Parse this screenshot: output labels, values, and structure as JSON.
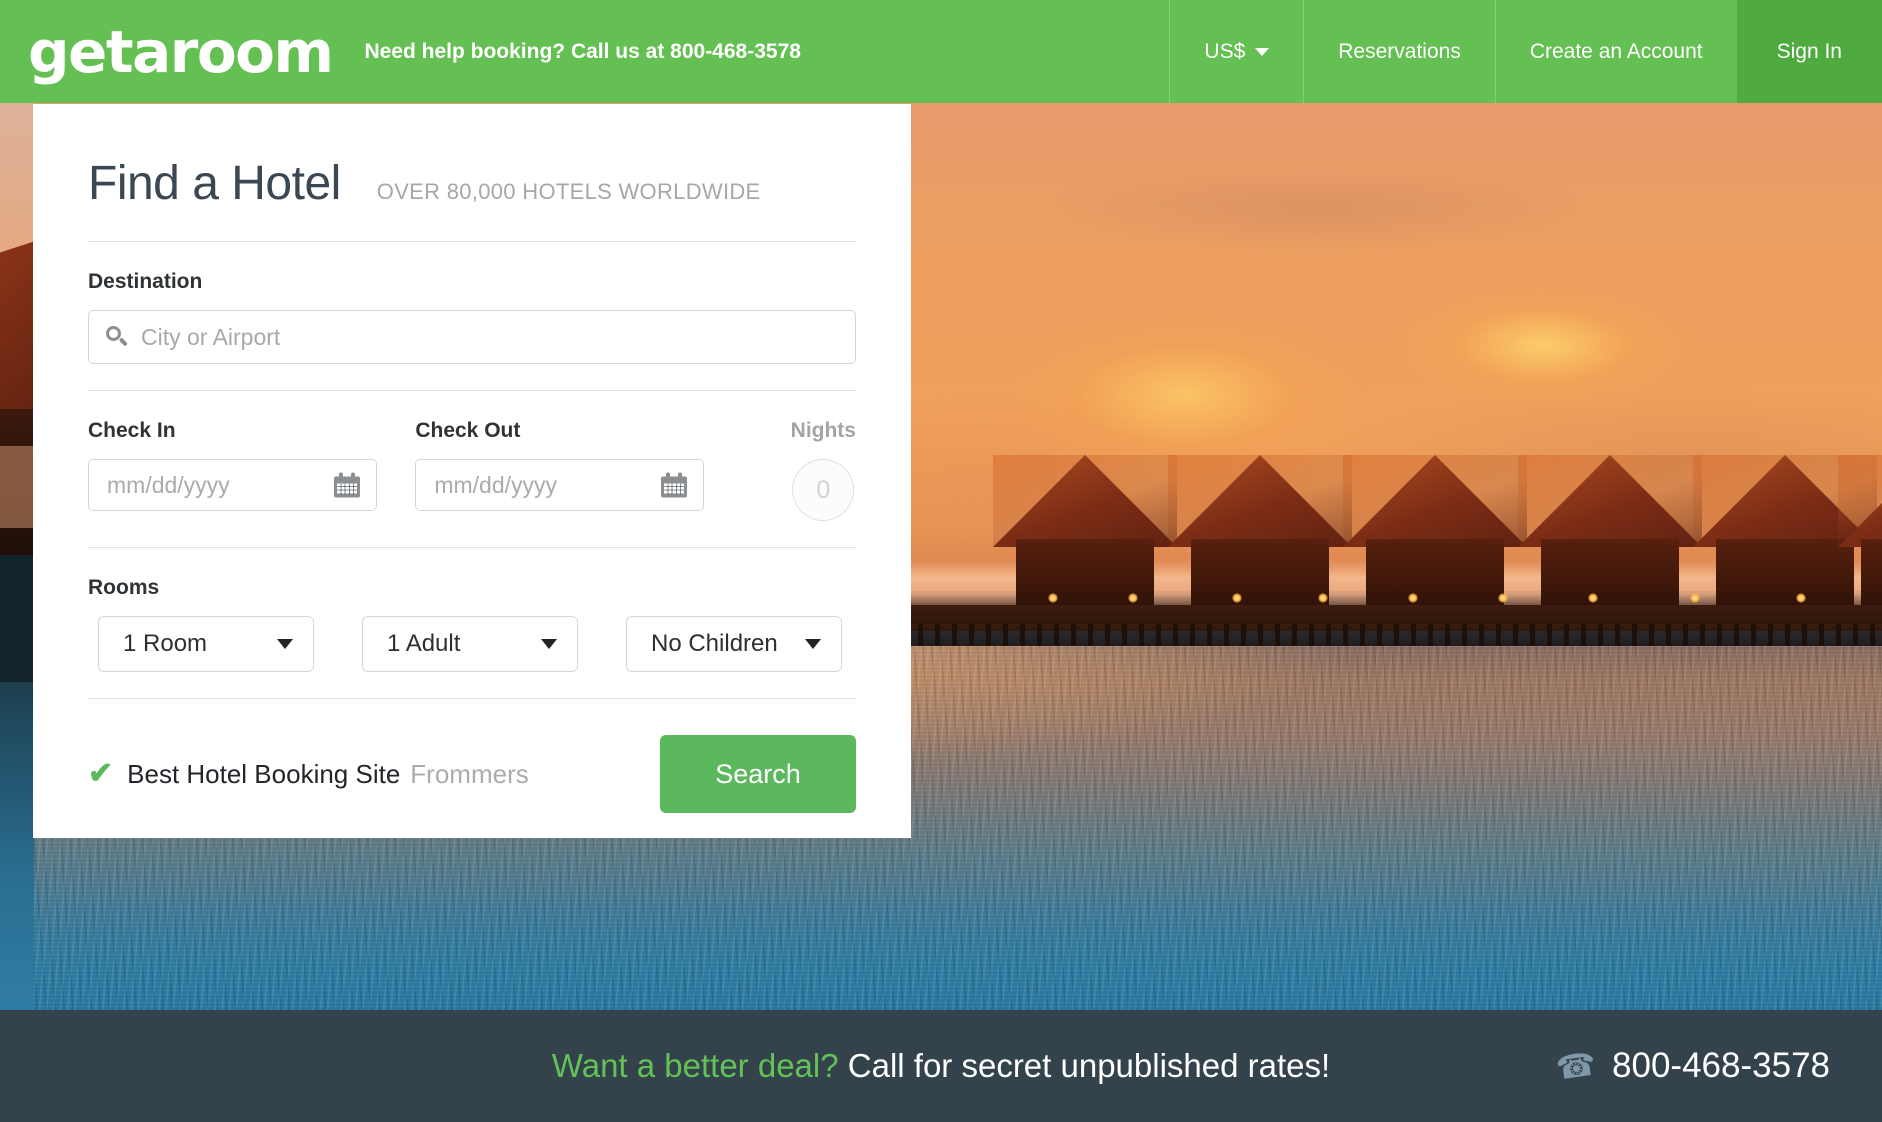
{
  "header": {
    "logo": "getaroom",
    "help_text": "Need help booking? Call us at 800-468-3578",
    "nav": [
      {
        "label": "US$",
        "icon": "chevron-down-icon",
        "has_caret": true
      },
      {
        "label": "Reservations",
        "has_caret": false
      },
      {
        "label": "Create an Account",
        "has_caret": false
      },
      {
        "label": "Sign In",
        "has_caret": false,
        "active": true
      }
    ]
  },
  "card": {
    "title": "Find a Hotel",
    "subtitle": "OVER 80,000 HOTELS WORLDWIDE",
    "destination": {
      "label": "Destination",
      "placeholder": "City or Airport",
      "value": "",
      "icon": "search-icon"
    },
    "check_in": {
      "label": "Check In",
      "placeholder": "mm/dd/yyyy",
      "value": "",
      "icon": "calendar-icon"
    },
    "check_out": {
      "label": "Check Out",
      "placeholder": "mm/dd/yyyy",
      "value": "",
      "icon": "calendar-icon"
    },
    "nights": {
      "label": "Nights",
      "value": "0"
    },
    "rooms": {
      "label": "Rooms",
      "selects": [
        {
          "value": "1 Room",
          "name": "rooms-select"
        },
        {
          "value": "1 Adult",
          "name": "adults-select"
        },
        {
          "value": "No Children",
          "name": "children-select"
        }
      ]
    },
    "badge": {
      "check_icon": "check-icon",
      "text": "Best Hotel Booking Site",
      "source": "Frommers"
    },
    "search_button": "Search"
  },
  "bottom_bar": {
    "highlight": "Want a better deal?",
    "message": "Call for secret unpublished rates!",
    "phone": "800-468-3578",
    "phone_icon": "phone-icon"
  },
  "colors": {
    "brand_green": "#64c052",
    "signin_green": "#4faa3f",
    "button_green": "#5cb85c",
    "bottom_bar": "#33424b",
    "title_color": "#3b4753",
    "muted_text": "#a4a8ab",
    "phone_icon": "#7e98a8"
  }
}
